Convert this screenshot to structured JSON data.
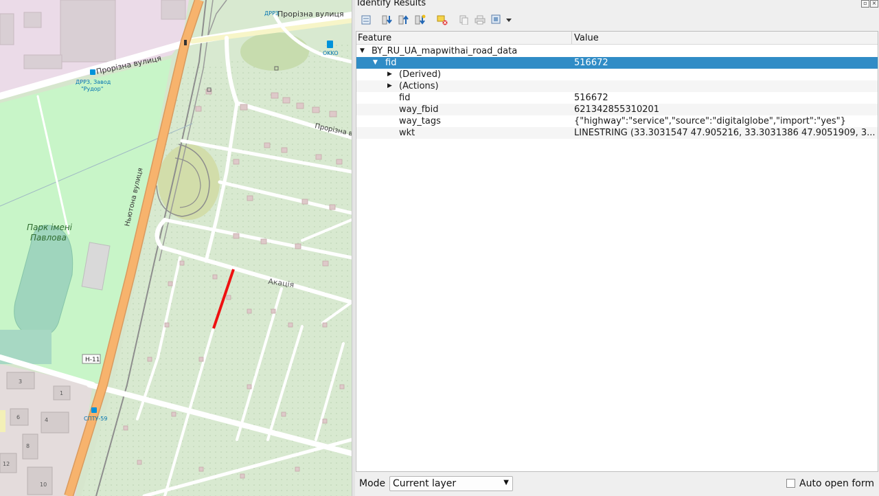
{
  "map": {
    "labels": {
      "street_top": "Прорізна вулиця",
      "street_left": "Прорізна вулиця",
      "street_right": "Прорізна вули",
      "road_newton": "Ньютона вулиця",
      "park_line1": "Парк імені",
      "park_line2": "Павлова",
      "akatsia": "Акація",
      "drrz_top": "ДРРЗ",
      "okko": "OKKO",
      "drrz_line1": "ДРРЗ, Завод",
      "drrz_line2": "\"Рудор\"",
      "sptu": "СПТУ-59",
      "route": "Н-11",
      "house_3": "3",
      "house_1": "1",
      "house_6": "6",
      "house_4": "4",
      "house_8": "8",
      "house_12": "12",
      "house_10": "10"
    },
    "colors": {
      "residential": "#d8e9d0",
      "park": "#c8f5c8",
      "industrial": "#ebdbe8",
      "stadium": "#9fd5bd",
      "primary_road": "#f7b36d",
      "highlight": "#ee1111"
    }
  },
  "panel": {
    "title": "Identify Results",
    "toolbar": [
      {
        "icon": "expand-tree-icon"
      },
      {
        "icon": "collapse-all-icon"
      },
      {
        "icon": "expand-all-icon"
      },
      {
        "icon": "expand-new-icon"
      },
      {
        "icon": "clear-results-icon"
      },
      {
        "icon": "copy-icon"
      },
      {
        "icon": "print-icon"
      },
      {
        "icon": "select-mode-icon"
      }
    ],
    "columns": {
      "feature": "Feature",
      "value": "Value"
    },
    "layer": "BY_RU_UA_mapwithai_road_data",
    "selected": {
      "field": "fid",
      "value": "516672"
    },
    "derived": "(Derived)",
    "actions": "(Actions)",
    "attributes": [
      {
        "name": "fid",
        "value": "516672"
      },
      {
        "name": "way_fbid",
        "value": "621342855310201"
      },
      {
        "name": "way_tags",
        "value": "{\"highway\":\"service\",\"source\":\"digitalglobe\",\"import\":\"yes\"}"
      },
      {
        "name": "wkt",
        "value": "LINESTRING (33.3031547 47.905216, 33.3031386 47.9051909, 3..."
      }
    ],
    "mode_label": "Mode",
    "mode_value": "Current layer",
    "auto_open": "Auto open form",
    "accent": "#308cc6"
  }
}
